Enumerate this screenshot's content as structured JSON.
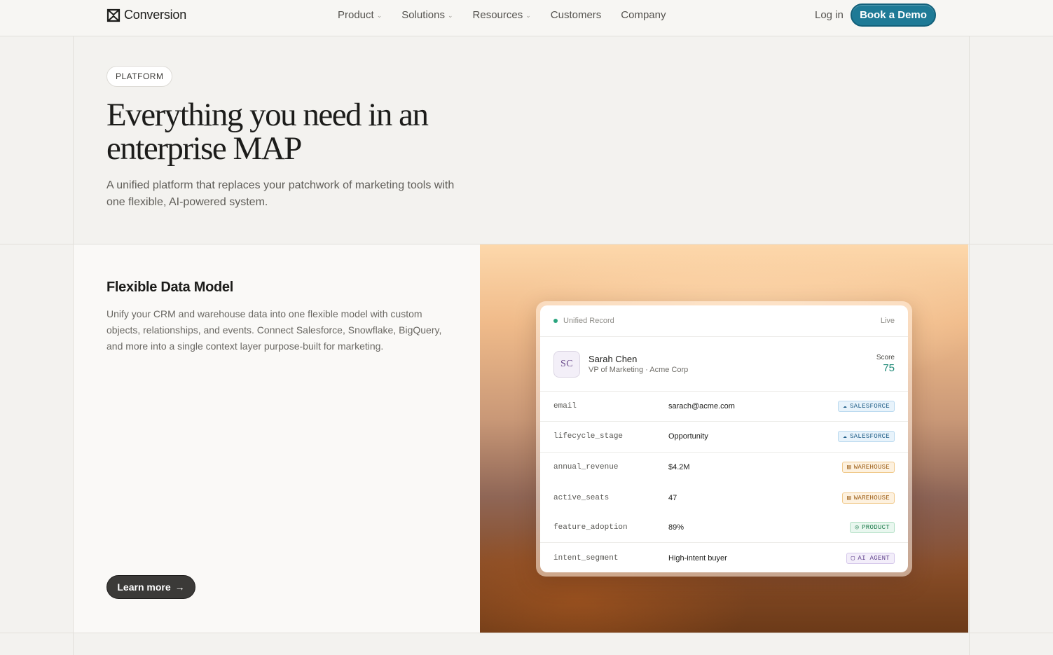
{
  "nav": {
    "logo_text": "Conversion",
    "links": [
      {
        "label": "Product",
        "dropdown": true
      },
      {
        "label": "Solutions",
        "dropdown": true
      },
      {
        "label": "Resources",
        "dropdown": true
      },
      {
        "label": "Customers",
        "dropdown": false
      },
      {
        "label": "Company",
        "dropdown": false
      }
    ],
    "login_label": "Log in",
    "demo_label": "Book a Demo"
  },
  "hero": {
    "pill": "PLATFORM",
    "title": "Everything you need in an enterprise MAP",
    "subtitle": "A unified platform that replaces your patchwork of marketing tools with one flexible, AI-powered system."
  },
  "feature": {
    "title": "Flexible Data Model",
    "description": "Unify your CRM and warehouse data into one flexible model with custom objects, relationships, and events. Connect Salesforce, Snowflake, BigQuery, and more into a single context layer purpose-built for marketing.",
    "cta_label": "Learn more"
  },
  "record_card": {
    "header_label": "Unified Record",
    "status": "Live",
    "profile": {
      "initials": "SC",
      "name": "Sarah Chen",
      "role": "VP of Marketing · Acme Corp",
      "score_label": "Score",
      "score_value": "75"
    },
    "rows": [
      {
        "field": "email",
        "value": "sarach@acme.com",
        "source": "SALESFORCE",
        "source_icon": "cloud-icon",
        "kind": "sf"
      },
      {
        "field": "lifecycle_stage",
        "value": "Opportunity",
        "source": "SALESFORCE",
        "source_icon": "cloud-icon",
        "kind": "sf"
      },
      {
        "field": "annual_revenue",
        "value": "$4.2M",
        "source": "WAREHOUSE",
        "source_icon": "database-icon",
        "kind": "wh"
      },
      {
        "field": "active_seats",
        "value": "47",
        "source": "WAREHOUSE",
        "source_icon": "database-icon",
        "kind": "wh"
      },
      {
        "field": "feature_adoption",
        "value": "89%",
        "source": "PRODUCT",
        "source_icon": "globe-icon",
        "kind": "pr"
      },
      {
        "field": "intent_segment",
        "value": "High-intent buyer",
        "source": "AI AGENT",
        "source_icon": "robot-icon",
        "kind": "ai"
      }
    ]
  },
  "colors": {
    "accent": "#1e7a96",
    "score": "#1f8a77",
    "live_dot": "#2aa57f"
  }
}
